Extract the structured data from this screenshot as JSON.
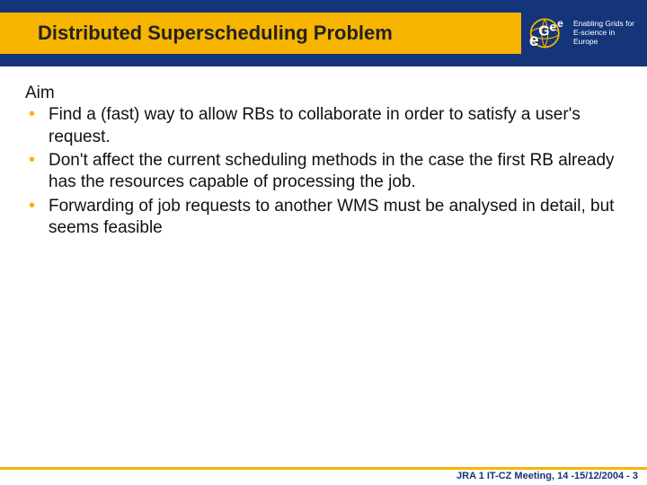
{
  "header": {
    "title": "Distributed Superscheduling Problem",
    "logo": {
      "acronym": "eGee",
      "tag1": "Enabling Grids for",
      "tag2": "E-science in Europe"
    }
  },
  "content": {
    "aim_label": "Aim",
    "bullets": [
      "Find a (fast) way to allow RBs to collaborate  in order to satisfy a user's request.",
      "Don't affect the current scheduling methods in the case the first RB already has the resources capable of processing the job.",
      "Forwarding of job requests to another WMS must be analysed in detail, but seems feasible"
    ]
  },
  "footer": {
    "text": "JRA 1 IT-CZ Meeting, 14 -15/12/2004  - 3"
  }
}
